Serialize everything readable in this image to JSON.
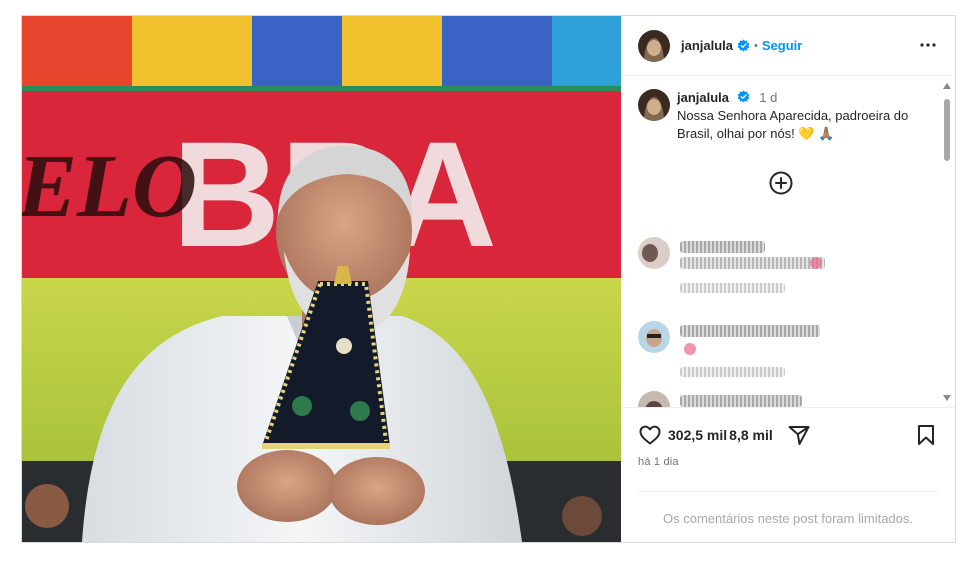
{
  "post": {
    "image_description_icon": "photo",
    "header": {
      "username": "janjalula",
      "verified_icon": "verified-badge-icon",
      "separator": "•",
      "follow_label": "Seguir",
      "more_icon": "more-options-icon"
    },
    "caption": {
      "username": "janjalula",
      "time": "1 d",
      "text": "Nossa Senhora Aparecida, padroeira do Brasil, olhai por nós! 💛 🙏🏽"
    },
    "load_more_icon": "plus-circle-icon",
    "comments": [
      {
        "state": "blurred"
      },
      {
        "state": "blurred"
      },
      {
        "state": "blurred"
      }
    ],
    "actions": {
      "like_icon": "heart-icon",
      "like_count": "302,5 mil",
      "comment_count": "8,8 mil",
      "share_icon": "send-icon",
      "save_icon": "bookmark-icon"
    },
    "date": "há 1 dia",
    "limited_notice": "Os comentários neste post foram limitados.",
    "colors": {
      "accent": "#0095f6",
      "verified": "#0095f6",
      "muted": "#737373",
      "border": "#dbdbdb"
    }
  }
}
